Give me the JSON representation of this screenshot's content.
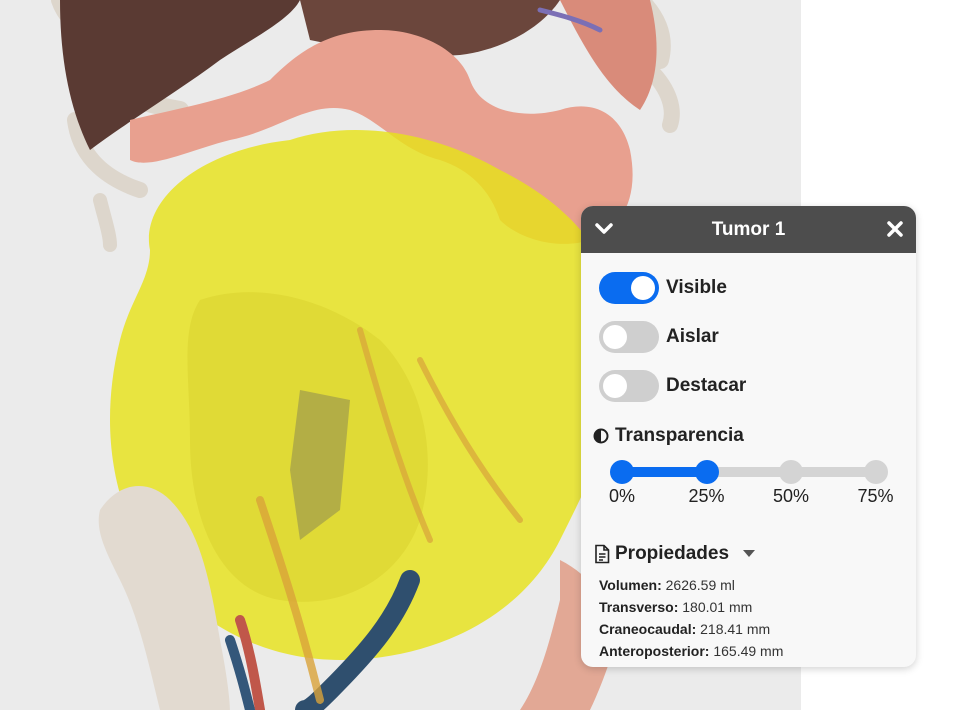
{
  "panel": {
    "title": "Tumor 1",
    "toggles": [
      {
        "label": "Visible",
        "on": true
      },
      {
        "label": "Aislar",
        "on": false
      },
      {
        "label": "Destacar",
        "on": false
      }
    ],
    "transparency": {
      "label": "Transparencia",
      "value_percent": 25,
      "ticks": [
        "0%",
        "25%",
        "50%",
        "75%"
      ]
    },
    "properties": {
      "label": "Propiedades",
      "items": [
        {
          "key": "Volumen:",
          "value": "2626.59 ml"
        },
        {
          "key": "Transverso:",
          "value": "180.01 mm"
        },
        {
          "key": "Craneocaudal:",
          "value": "218.41 mm"
        },
        {
          "key": "Anteroposterior:",
          "value": "165.49 mm"
        }
      ]
    }
  },
  "colors": {
    "header_bg": "#4d4d4d",
    "accent": "#0a6cf0",
    "tumor": "#e6e21a",
    "viewport_bg": "#ebebeb"
  },
  "icons": [
    "chevron-down-icon",
    "close-icon",
    "contrast-icon",
    "document-icon",
    "caret-down-icon"
  ]
}
